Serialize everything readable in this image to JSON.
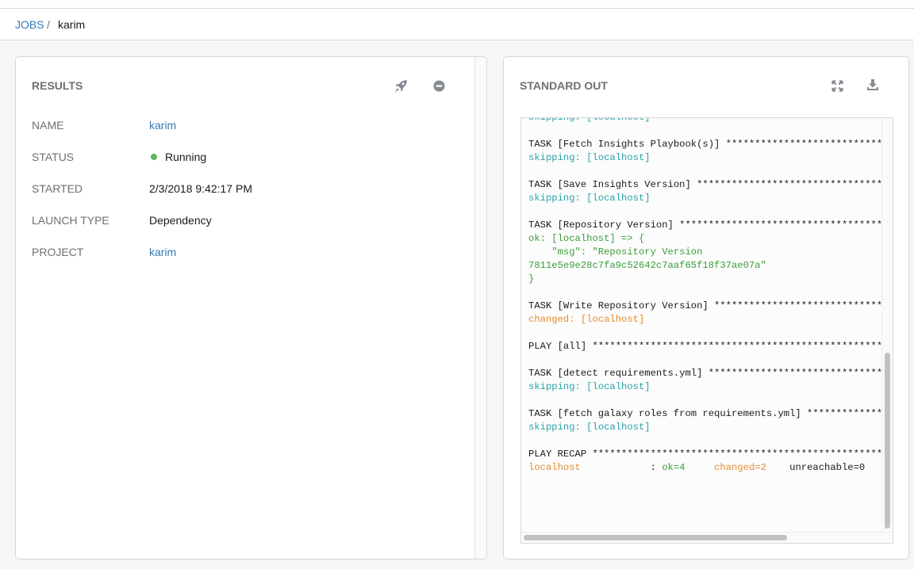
{
  "breadcrumb": {
    "root": "JOBS",
    "separator": "/",
    "current": "karim"
  },
  "results": {
    "title": "RESULTS",
    "icons": [
      "rocket-icon",
      "minus-circle-icon"
    ],
    "details": [
      {
        "label": "NAME",
        "value": "karim",
        "link": true
      },
      {
        "label": "STATUS",
        "value": "Running",
        "status_color": "#5cb85c"
      },
      {
        "label": "STARTED",
        "value": "2/3/2018 9:42:17 PM"
      },
      {
        "label": "LAUNCH TYPE",
        "value": "Dependency"
      },
      {
        "label": "PROJECT",
        "value": "karim",
        "link": true
      }
    ]
  },
  "stdout": {
    "title": "STANDARD OUT",
    "icons": [
      "expand-icon",
      "download-icon"
    ],
    "lines": [
      {
        "text": "skipping: [localhost]",
        "kind": "skip"
      },
      {
        "text": "",
        "kind": "default"
      },
      {
        "text": "TASK [Fetch Insights Playbook(s)] ****************************************",
        "kind": "default"
      },
      {
        "text": "skipping: [localhost]",
        "kind": "skip"
      },
      {
        "text": "",
        "kind": "default"
      },
      {
        "text": "TASK [Save Insights Version] *********************************************",
        "kind": "default"
      },
      {
        "text": "skipping: [localhost]",
        "kind": "skip"
      },
      {
        "text": "",
        "kind": "default"
      },
      {
        "text": "TASK [Repository Version] ************************************************",
        "kind": "default"
      },
      {
        "text": "ok: [localhost] => {",
        "kind": "ok"
      },
      {
        "text": "    \"msg\": \"Repository Version",
        "kind": "ok"
      },
      {
        "text": "7811e5e9e28c7fa9c52642c7aaf65f18f37ae07a\"",
        "kind": "ok"
      },
      {
        "text": "}",
        "kind": "ok"
      },
      {
        "text": "",
        "kind": "default"
      },
      {
        "text": "TASK [Write Repository Version] ******************************************",
        "kind": "default"
      },
      {
        "text": "changed: [localhost]",
        "kind": "changed"
      },
      {
        "text": "",
        "kind": "default"
      },
      {
        "text": "PLAY [all] ***************************************************************",
        "kind": "default"
      },
      {
        "text": "",
        "kind": "default"
      },
      {
        "text": "TASK [detect requirements.yml] *******************************************",
        "kind": "default"
      },
      {
        "text": "skipping: [localhost]",
        "kind": "skip"
      },
      {
        "text": "",
        "kind": "default"
      },
      {
        "text": "TASK [fetch galaxy roles from requirements.yml] **************************",
        "kind": "default"
      },
      {
        "text": "skipping: [localhost]",
        "kind": "skip"
      },
      {
        "text": "",
        "kind": "default"
      },
      {
        "text": "PLAY RECAP ***************************************************************",
        "kind": "default"
      },
      {
        "kind": "recap",
        "host": "localhost",
        "sep": ": ",
        "ok": "ok=4",
        "changed": "changed=2",
        "rest": "unreachable=0"
      }
    ]
  },
  "colors": {
    "link": "#337ab7",
    "skip": "#2ba2a9",
    "ok": "#3c9c3c",
    "changed": "#e68c2e",
    "running": "#5cb85c"
  }
}
